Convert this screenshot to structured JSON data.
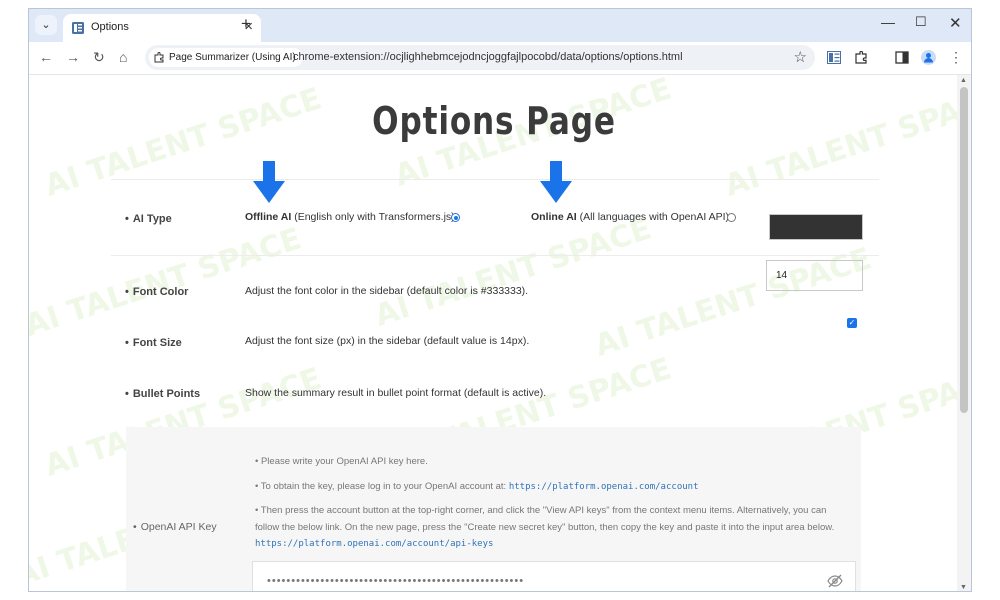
{
  "browser": {
    "tab_title": "Options",
    "tab_close": "×",
    "new_tab": "+",
    "extension_chip": "Page Summarizer (Using AI)",
    "url": "chrome-extension://ocjlighhebmcejodncjoggfajlpocobd/data/options/options.html"
  },
  "watermark": "AI TALENT SPACE",
  "page": {
    "title": "Options Page"
  },
  "ai_type": {
    "label": "AI Type",
    "offline_bold": "Offline AI",
    "offline_rest": " (English only with Transformers.js)",
    "online_bold": "Online AI",
    "online_rest": " (All languages with OpenAI API)",
    "selected": "offline"
  },
  "font_color": {
    "label": "Font Color",
    "desc": "Adjust the font color in the sidebar (default color is #333333).",
    "value": "#333333"
  },
  "font_size": {
    "label": "Font Size",
    "desc": "Adjust the font size (px) in the sidebar (default value is 14px).",
    "value": "14"
  },
  "bullet_points": {
    "label": "Bullet Points",
    "desc": "Show the summary result in bullet point format (default is active).",
    "checked": true
  },
  "api_key": {
    "label": "OpenAI API Key",
    "line1": "Please write your OpenAI API key here.",
    "line2_text": "To obtain the key, please log in to your OpenAI account at: ",
    "line2_link": "https://platform.openai.com/account",
    "line3_text_a": "Then press the account button at the top-right corner, and click the \"View API keys\" from the context menu items. Alternatively, you can",
    "line3_text_b": "follow the below link. On the new page, press the \"Create new secret key\" button, then copy the key and paste it into the input area below.",
    "line3_link": "https://platform.openai.com/account/api-keys",
    "masked_value": "•••••••••••••••••••••••••••••••••••••••••••••••••••••"
  },
  "colors": {
    "accent": "#1a73e8",
    "arrow": "#1a73e8",
    "title": "#3b3b3b",
    "watermark": "#82c846"
  }
}
